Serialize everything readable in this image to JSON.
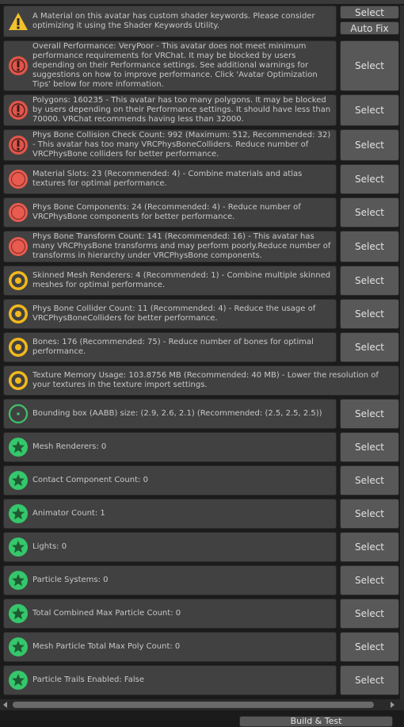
{
  "validations": [
    {
      "level": "warning",
      "text": "A Material on this avatar has custom shader keywords. Please consider optimizing it using the Shader Keywords Utility.",
      "buttons": [
        "Select",
        "Auto Fix"
      ]
    },
    {
      "level": "error",
      "text": "Overall Performance: VeryPoor - This avatar does not meet minimum performance requirements for VRChat. It may be blocked by users depending on their Performance settings. See additional warnings for suggestions on how to improve performance. Click 'Avatar Optimization Tips' below for more information.",
      "buttons": [
        "Select"
      ]
    },
    {
      "level": "error",
      "text": "Polygons: 160235 - This avatar has too many polygons. It may be blocked by users depending on their Performance settings. It should have less than 70000. VRChat recommends having less than 32000.",
      "buttons": [
        "Select"
      ]
    },
    {
      "level": "error",
      "text": "Phys Bone Collision Check Count: 992 (Maximum: 512, Recommended: 32) - This avatar has too many VRCPhysBoneColliders. Reduce number of VRCPhysBone colliders for better performance.",
      "buttons": [
        "Select"
      ]
    },
    {
      "level": "poor",
      "text": "Material Slots: 23 (Recommended: 4) - Combine materials and atlas textures for optimal performance.",
      "buttons": [
        "Select"
      ]
    },
    {
      "level": "poor",
      "text": "Phys Bone Components: 24 (Recommended: 4) - Reduce number of VRCPhysBone components for better performance.",
      "buttons": [
        "Select"
      ]
    },
    {
      "level": "poor",
      "text": "Phys Bone Transform Count: 141 (Recommended: 16) - This avatar has many VRCPhysBone transforms and may perform poorly.Reduce number of transforms in hierarchy under VRCPhysBone components.",
      "buttons": [
        "Select"
      ]
    },
    {
      "level": "medium",
      "text": "Skinned Mesh Renderers: 4 (Recommended: 1) - Combine multiple skinned meshes for optimal performance.",
      "buttons": [
        "Select"
      ]
    },
    {
      "level": "medium",
      "text": "Phys Bone Collider Count: 11 (Recommended: 4) - Reduce the usage of VRCPhysBoneColliders for better performance.",
      "buttons": [
        "Select"
      ]
    },
    {
      "level": "medium",
      "text": "Bones: 176 (Recommended: 75) - Reduce number of bones for optimal performance.",
      "buttons": [
        "Select"
      ]
    },
    {
      "level": "medium",
      "text": "Texture Memory Usage: 103.8756 MB (Recommended: 40 MB) - Lower the resolution of your textures in the texture import settings.",
      "buttons": []
    },
    {
      "level": "good",
      "text": "Bounding box (AABB) size: (2.9, 2.6, 2.1) (Recommended: (2.5, 2.5, 2.5))",
      "buttons": [
        "Select"
      ]
    },
    {
      "level": "excellent",
      "text": "Mesh Renderers: 0",
      "buttons": [
        "Select"
      ]
    },
    {
      "level": "excellent",
      "text": "Contact Component Count: 0",
      "buttons": [
        "Select"
      ]
    },
    {
      "level": "excellent",
      "text": "Animator Count: 1",
      "buttons": [
        "Select"
      ]
    },
    {
      "level": "excellent",
      "text": "Lights: 0",
      "buttons": [
        "Select"
      ]
    },
    {
      "level": "excellent",
      "text": "Particle Systems: 0",
      "buttons": [
        "Select"
      ]
    },
    {
      "level": "excellent",
      "text": "Total Combined Max Particle Count: 0",
      "buttons": [
        "Select"
      ]
    },
    {
      "level": "excellent",
      "text": "Mesh Particle Total Max Poly Count: 0",
      "buttons": [
        "Select"
      ]
    },
    {
      "level": "excellent",
      "text": "Particle Trails Enabled: False",
      "buttons": [
        "Select"
      ]
    }
  ],
  "icons": {
    "warning": "warning-triangle-icon",
    "error": "error-exclamation-icon",
    "poor": "perf-poor-icon",
    "medium": "perf-medium-icon",
    "good": "perf-good-icon",
    "excellent": "perf-excellent-star-icon"
  },
  "colors": {
    "warning": "#f2c12e",
    "error": "#e0554a",
    "poor": "#e85b4f",
    "medium": "#f2b81c",
    "good": "#3fc26a",
    "excellent": "#35c76b"
  },
  "bottom_button": "Build & Test"
}
